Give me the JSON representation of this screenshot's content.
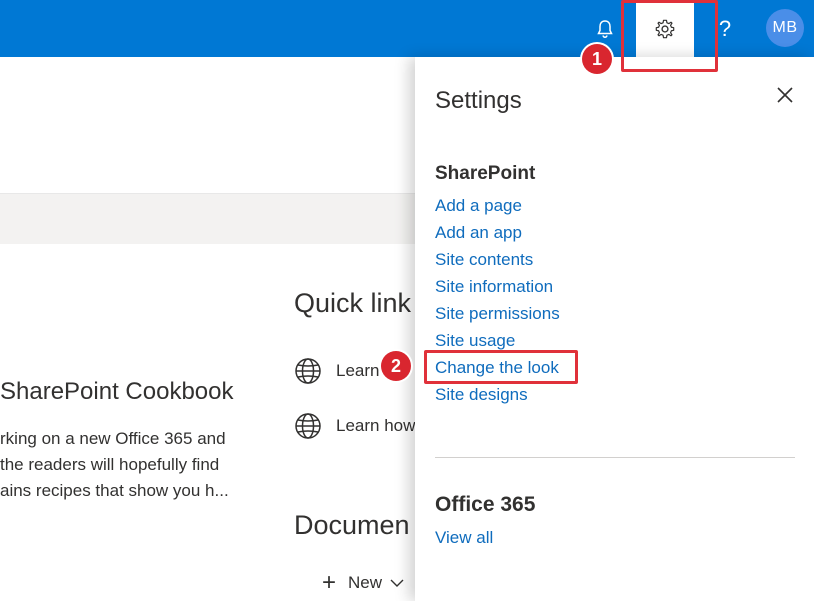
{
  "topbar": {
    "help_label": "?",
    "avatar_initials": "MB",
    "accent_color": "#0078d4",
    "icons": [
      "bell-icon",
      "gear-icon",
      "help-icon"
    ]
  },
  "background_page": {
    "site_title": "SharePoint Cookbook",
    "description_lines": [
      "rking on a new Office 365 and",
      "the readers will hopefully find",
      "ains recipes that show you h..."
    ],
    "quick_links": {
      "heading": "Quick link",
      "items": [
        "Learn",
        "Learn how"
      ]
    },
    "documents": {
      "heading": "Documen",
      "new_label": "New"
    }
  },
  "settings_panel": {
    "title": "Settings",
    "sharepoint": {
      "heading": "SharePoint",
      "links": [
        "Add a page",
        "Add an app",
        "Site contents",
        "Site information",
        "Site permissions",
        "Site usage",
        "Change the look",
        "Site designs"
      ]
    },
    "office365": {
      "heading": "Office 365",
      "link": "View all"
    }
  },
  "annotations": {
    "badge1": "1",
    "badge2": "2",
    "highlight_color": "#e0313a"
  }
}
